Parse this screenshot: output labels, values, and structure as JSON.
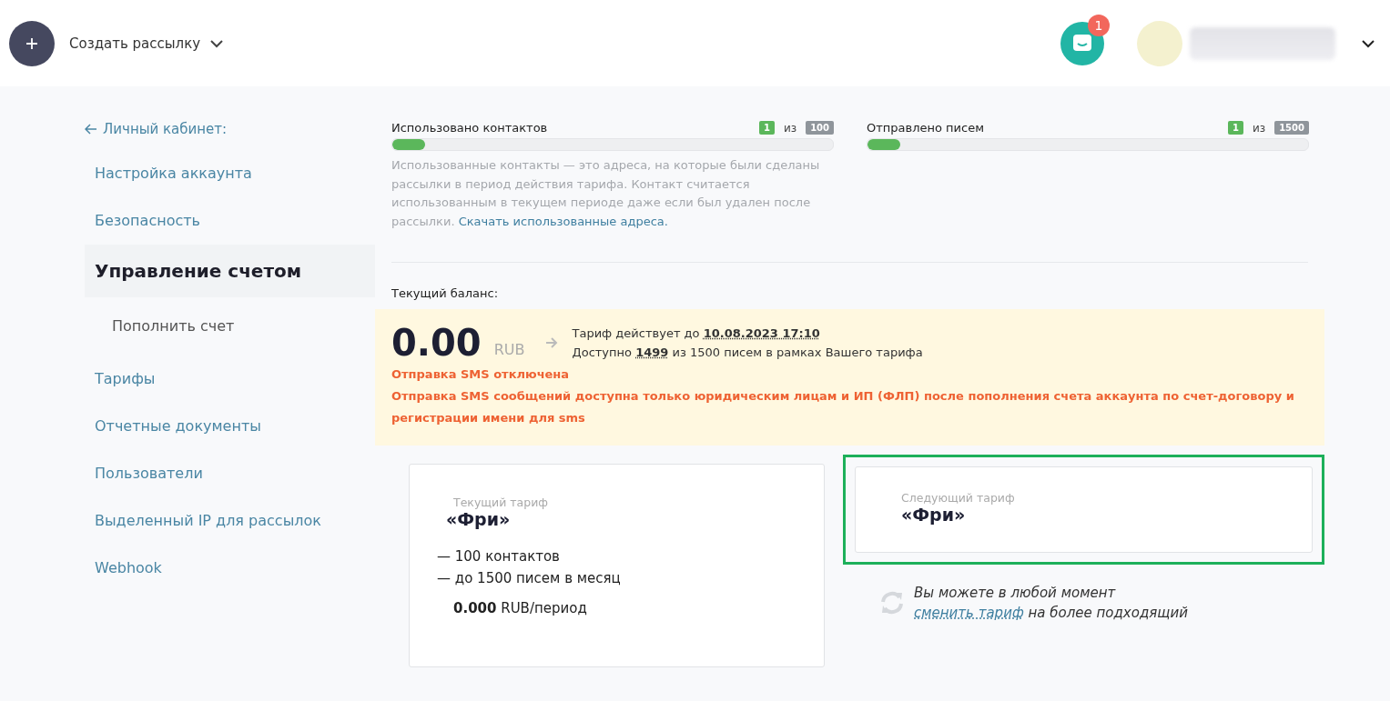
{
  "header": {
    "create_button": {
      "label": "Создать рассылку"
    },
    "notifications": {
      "count": "1"
    }
  },
  "sidebar": {
    "back_link": "Личный кабинет:",
    "items": [
      {
        "label": "Настройка аккаунта",
        "kind": "link",
        "selected": false
      },
      {
        "label": "Безопасность",
        "kind": "link",
        "selected": false
      },
      {
        "label": "Управление счетом",
        "kind": "link",
        "selected": true
      },
      {
        "label": "Пополнить счет",
        "kind": "subitem",
        "selected": false
      },
      {
        "label": "Тарифы",
        "kind": "link",
        "selected": false
      },
      {
        "label": "Отчетные документы",
        "kind": "link",
        "selected": false
      },
      {
        "label": "Пользователи",
        "kind": "link",
        "selected": false
      },
      {
        "label": "Выделенный IP для рассылок",
        "kind": "link",
        "selected": false
      },
      {
        "label": "Webhook",
        "kind": "link",
        "selected": false
      }
    ]
  },
  "usage": [
    {
      "label": "Использовано контактов",
      "used": "1",
      "of": "из",
      "total": "100",
      "level": 0.075
    },
    {
      "label": "Отправлено писем",
      "used": "1",
      "of": "из",
      "total": "1500",
      "level": 0.075
    }
  ],
  "usage_note": {
    "text": "Использованные контакты — это адреса, на которые были сделаны рассылки в период действия тарифа. Контакт считается использованным в текущем периоде даже если был удален после рассылки.",
    "link": "Скачать использованные адреса."
  },
  "balance": {
    "label": "Текущий баланс:",
    "amount": "0.00",
    "currency": "RUB",
    "valid_until": "Тариф действует до **10.08.2023 17:10**",
    "available": "Доступно **1499** из 1500 писем в рамках Вашего тарифа",
    "sms_status": "Отправка SMS отключена",
    "sms_note": "Отправка SMS сообщений доступна только юридическим лицам и ИП (ФЛП) после пополнения счета аккаунта по счет-договору и регистрации имени для sms"
  },
  "tariffs": {
    "current": {
      "caption": "Текущий тариф",
      "name": "«Фри»",
      "features": [
        "— 100 контактов",
        "— до 1500 писем в месяц"
      ],
      "price": "**0.000** RUB/период"
    },
    "next": {
      "caption": "Следующий тариф",
      "name": "«Фри»",
      "highlighted": true
    }
  },
  "change_note": {
    "line1": "Вы можете в любой момент",
    "link": "сменить тариф",
    "rest": "на более подходящий"
  }
}
